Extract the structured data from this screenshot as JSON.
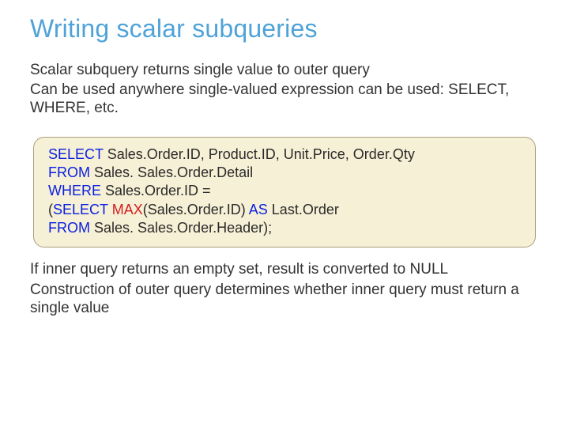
{
  "title": "Writing scalar subqueries",
  "intro": {
    "l1": "Scalar subquery returns single value to outer query",
    "l2": "Can be used anywhere single-valued expression can be used: SELECT, WHERE, etc."
  },
  "code": {
    "select_kw": "SELECT",
    "select_cols": " Sales.Order.ID, Product.ID, Unit.Price, Order.Qty",
    "from_kw": "FROM",
    "from_table": " Sales. Sales.Order.Detail",
    "where_kw": "WHERE",
    "where_expr": " Sales.Order.ID =",
    "sub_open": "(",
    "sub_select_kw": "SELECT",
    "sub_space1": " ",
    "max_kw": "MAX",
    "sub_args": "(Sales.Order.ID) ",
    "as_kw": "AS",
    "sub_alias": " Last.Order",
    "sub_from_kw": "FROM",
    "sub_from_table": " Sales. Sales.Order.Header);"
  },
  "outro": {
    "l1": "If inner query returns an empty set, result is converted to NULL",
    "l2": "Construction of outer query determines whether inner query must return a single value"
  }
}
